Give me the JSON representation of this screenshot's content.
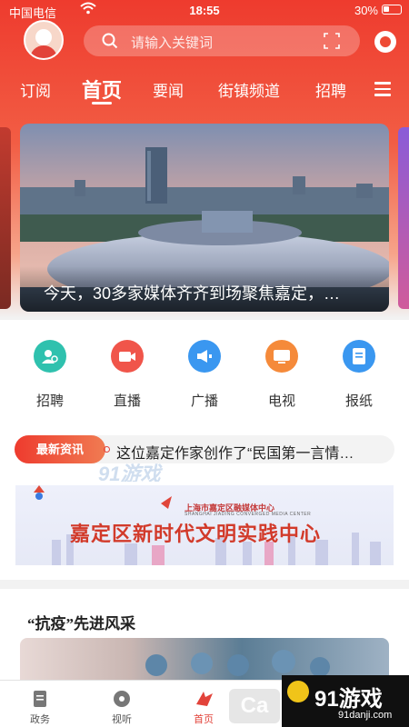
{
  "status_bar": {
    "carrier": "中国电信",
    "time": "18:55",
    "battery": "30%"
  },
  "search": {
    "placeholder": "请输入关键词"
  },
  "nav": {
    "tabs": [
      "订阅",
      "首页",
      "要闻",
      "街镇频道",
      "招聘"
    ],
    "active": "首页"
  },
  "banner": {
    "caption": "今天，30多家媒体齐齐到场聚焦嘉定，…"
  },
  "quick_menu": [
    {
      "label": "招聘",
      "color": "#2fc1ae",
      "icon": "recruit-icon"
    },
    {
      "label": "直播",
      "color": "#f0554a",
      "icon": "live-icon"
    },
    {
      "label": "广播",
      "color": "#3a97f0",
      "icon": "broadcast-icon"
    },
    {
      "label": "电视",
      "color": "#f58a3a",
      "icon": "tv-icon"
    },
    {
      "label": "报纸",
      "color": "#3a97f0",
      "icon": "newspaper-icon"
    }
  ],
  "ticker": {
    "badge": "最新资讯",
    "text": "这位嘉定作家创作了“民国第一言情…",
    "watermark": "91游戏"
  },
  "ad": {
    "org": "上海市嘉定区融媒体中心",
    "org_en": "SHANGHAI JIADING CONVERGED MEDIA CENTER",
    "title": "嘉定区新时代文明实践中心"
  },
  "section": {
    "title": "“抗疫”先进风采"
  },
  "tabbar": [
    {
      "label": "政务",
      "icon": "document-icon"
    },
    {
      "label": "视听",
      "icon": "disc-icon"
    },
    {
      "label": "首页",
      "icon": "home-logo-icon",
      "active": true
    }
  ],
  "watermark": {
    "text": "91游戏",
    "url": "91danji.com",
    "ca": "Ca"
  },
  "colors": {
    "primary": "#ee3b2e",
    "accent": "#e2433a"
  }
}
